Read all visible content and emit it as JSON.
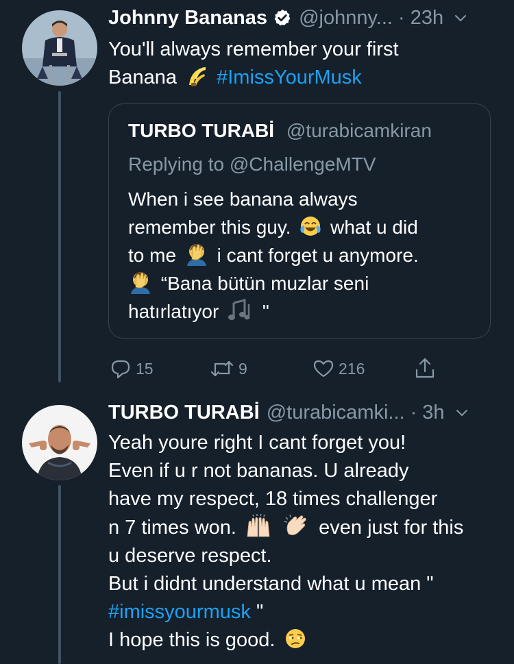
{
  "tweet1": {
    "name": "Johnny Bananas",
    "handle": "@johnny...",
    "time": "· 23h",
    "text_line1": "You'll always remember your first",
    "text_line2_pre": "Banana",
    "hashtag": "#ImissYourMusk",
    "quote": {
      "name": "TURBO TURABİ",
      "handle": "@turabicamkiran",
      "reply_prefix": "Replying to",
      "reply_target": "@ChallengeMTV",
      "line1": "When i see banana always",
      "line2_a": "remember this guy.",
      "line2_b": "what u did",
      "line3_a": "to me",
      "line3_b": "i cant forget u anymore.",
      "line4": "“Bana bütün muzlar seni",
      "line5_a": "hatırlatıyor",
      "line5_b": "\""
    },
    "actions": {
      "replies": "15",
      "retweets": "9",
      "likes": "216"
    }
  },
  "tweet2": {
    "name": "TURBO TURABİ",
    "handle": "@turabicamki...",
    "time": "· 3h",
    "line1": "Yeah youre right I cant forget you!",
    "line2": "Even if u r not bananas. U already",
    "line3": "have my respect, 18 times challenger",
    "line4_a": "n 7 times won.",
    "line4_b": "even just for this",
    "line5": "u deserve respect.",
    "line6": "But i didnt understand what u mean  \"",
    "line7_hashtag": "#imissyourmusk",
    "line7_post": "\"",
    "line8": "I hope this is good."
  },
  "icons": {
    "verified": "verified-badge-icon",
    "caret": "chevron-down-icon",
    "banana": "banana-emoji",
    "laughing": "tears-of-joy-emoji",
    "facepalm": "facepalm-emoji",
    "notes": "musical-notes-emoji",
    "raised_hands": "raised-hands-emoji",
    "clapping": "clapping-hands-emoji",
    "unamused": "unamused-face-emoji",
    "reply": "reply-icon",
    "retweet": "retweet-icon",
    "like": "heart-icon",
    "share": "share-icon"
  },
  "colors": {
    "background": "#15202b",
    "text": "#ffffff",
    "secondary": "#8899a6",
    "link": "#1da1f2",
    "border": "#38444d"
  }
}
